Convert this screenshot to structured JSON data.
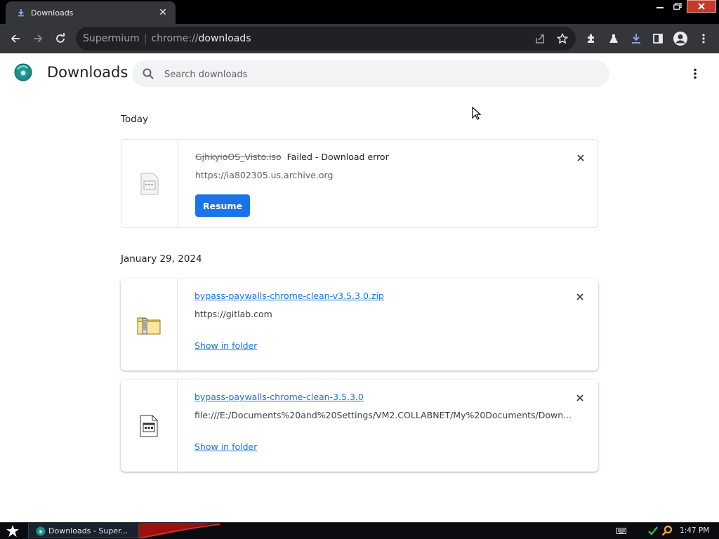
{
  "tab": {
    "title": "Downloads",
    "close_glyph": "✕"
  },
  "omnibox": {
    "brand": "Supermium",
    "separator": "|",
    "scheme": "chrome://",
    "path": "downloads"
  },
  "page": {
    "title": "Downloads"
  },
  "search": {
    "placeholder": "Search downloads"
  },
  "sections": [
    {
      "label": "Today"
    },
    {
      "label": "January 29, 2024"
    }
  ],
  "downloads": [
    {
      "file_name": "GjhkyioOS_Visto.iso",
      "status": "Failed - Download error",
      "url": "https://ia802305.us.archive.org",
      "action_label": "Resume",
      "state": "failed",
      "icon": "file-icon"
    },
    {
      "file_name": "bypass-paywalls-chrome-clean-v3.5.3.0.zip",
      "url": "https://gitlab.com",
      "action_label": "Show in folder",
      "state": "complete",
      "icon": "zip-folder-icon"
    },
    {
      "file_name": "bypass-paywalls-chrome-clean-3.5.3.0",
      "url": "file:///E:/Documents%20and%20Settings/VM2.COLLABNET/My%20Documents/Down...",
      "action_label": "Show in folder",
      "state": "complete",
      "icon": "file-icon"
    }
  ],
  "taskbar": {
    "task_label": "Downloads - Super...",
    "clock": "1:47 PM"
  },
  "colors": {
    "accent": "#1a73e8",
    "tab_bg": "#35363a",
    "toolbar_bg": "#35363a",
    "window_close": "#c8392b",
    "download_icon_active": "#8ab4f8"
  }
}
